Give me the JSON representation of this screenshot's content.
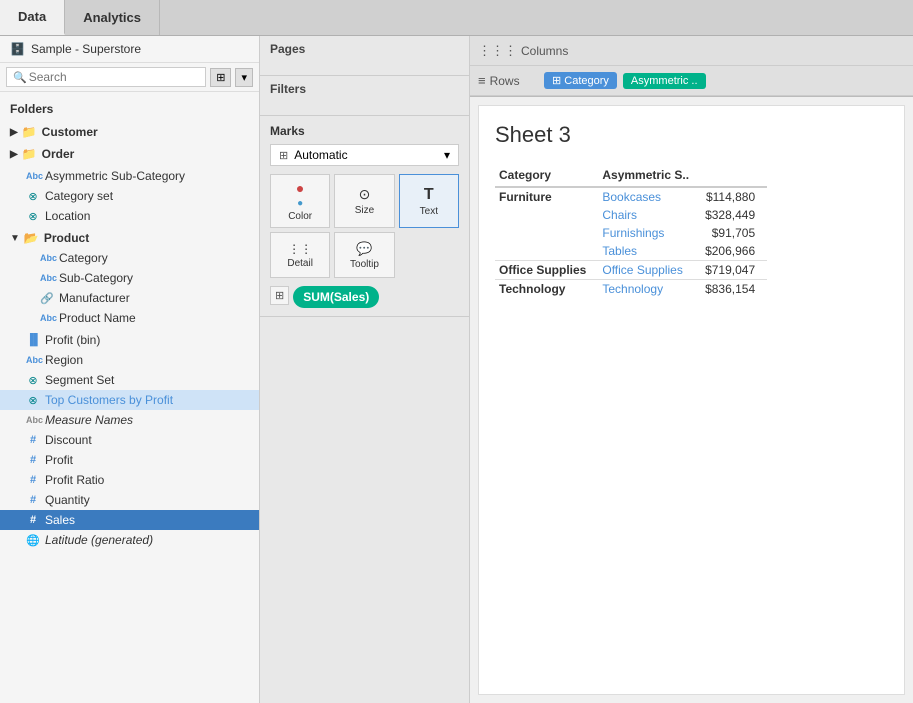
{
  "tabs": {
    "data_label": "Data",
    "analytics_label": "Analytics"
  },
  "left_panel": {
    "data_source": "Sample - Superstore",
    "search_placeholder": "Search",
    "folders_label": "Folders",
    "groups": [
      {
        "name": "Customer",
        "icon": "folder",
        "expanded": false,
        "items": []
      },
      {
        "name": "Order",
        "icon": "folder",
        "expanded": false,
        "items": []
      }
    ],
    "top_items": [
      {
        "name": "Asymmetric Sub-Category",
        "icon": "abc",
        "color": "blue",
        "indent": 1
      },
      {
        "name": "Category set",
        "icon": "set",
        "color": "teal",
        "indent": 1
      },
      {
        "name": "Location",
        "icon": "set",
        "color": "teal",
        "indent": 0
      },
      {
        "name": "Product",
        "icon": "folder-open",
        "color": "blue",
        "indent": 0,
        "is_group": true
      }
    ],
    "product_children": [
      {
        "name": "Category",
        "icon": "abc",
        "color": "blue"
      },
      {
        "name": "Sub-Category",
        "icon": "abc",
        "color": "blue"
      },
      {
        "name": "Manufacturer",
        "icon": "link",
        "color": "gray"
      },
      {
        "name": "Product Name",
        "icon": "abc",
        "color": "blue"
      }
    ],
    "bottom_items": [
      {
        "name": "Profit (bin)",
        "icon": "bar",
        "color": "blue"
      },
      {
        "name": "Region",
        "icon": "abc",
        "color": "blue"
      },
      {
        "name": "Segment Set",
        "icon": "set",
        "color": "teal"
      },
      {
        "name": "Top Customers by Profit",
        "icon": "set",
        "color": "teal",
        "highlight": true
      },
      {
        "name": "Measure Names",
        "icon": "abc",
        "color": "gray",
        "italic": true
      },
      {
        "name": "Discount",
        "icon": "hash",
        "color": "blue"
      },
      {
        "name": "Profit",
        "icon": "hash",
        "color": "blue"
      },
      {
        "name": "Profit Ratio",
        "icon": "hash",
        "color": "blue"
      },
      {
        "name": "Quantity",
        "icon": "hash",
        "color": "blue"
      },
      {
        "name": "Sales",
        "icon": "hash",
        "color": "blue",
        "selected": true
      },
      {
        "name": "Latitude (generated)",
        "icon": "globe",
        "color": "blue",
        "italic": true
      }
    ]
  },
  "middle_panel": {
    "pages_label": "Pages",
    "filters_label": "Filters",
    "marks_label": "Marks",
    "dropdown_value": "Automatic",
    "buttons": [
      {
        "label": "Color",
        "icon": "●●\n●●"
      },
      {
        "label": "Size",
        "icon": "◎"
      },
      {
        "label": "Text",
        "icon": "T"
      },
      {
        "label": "Detail",
        "icon": "⋮⋮"
      },
      {
        "label": "Tooltip",
        "icon": "💬"
      }
    ],
    "sum_sales_label": "SUM(Sales)"
  },
  "right_panel": {
    "columns_label": "Columns",
    "rows_label": "Rows",
    "rows_pills": [
      {
        "label": "⊞ Category",
        "color": "blue"
      },
      {
        "label": "Asymmetric ..",
        "color": "teal"
      }
    ],
    "sheet_title": "Sheet 3",
    "table_headers": [
      "Category",
      "Asymmetric S.."
    ],
    "table_data": [
      {
        "category": "Furniture",
        "rows": [
          {
            "sub": "Bookcases",
            "value": "$114,880"
          },
          {
            "sub": "Chairs",
            "value": "$328,449"
          },
          {
            "sub": "Furnishings",
            "value": "$91,705"
          },
          {
            "sub": "Tables",
            "value": "$206,966"
          }
        ]
      },
      {
        "category": "Office Supplies",
        "rows": [
          {
            "sub": "Office Supplies",
            "value": "$719,047"
          }
        ]
      },
      {
        "category": "Technology",
        "rows": [
          {
            "sub": "Technology",
            "value": "$836,154"
          }
        ]
      }
    ]
  }
}
